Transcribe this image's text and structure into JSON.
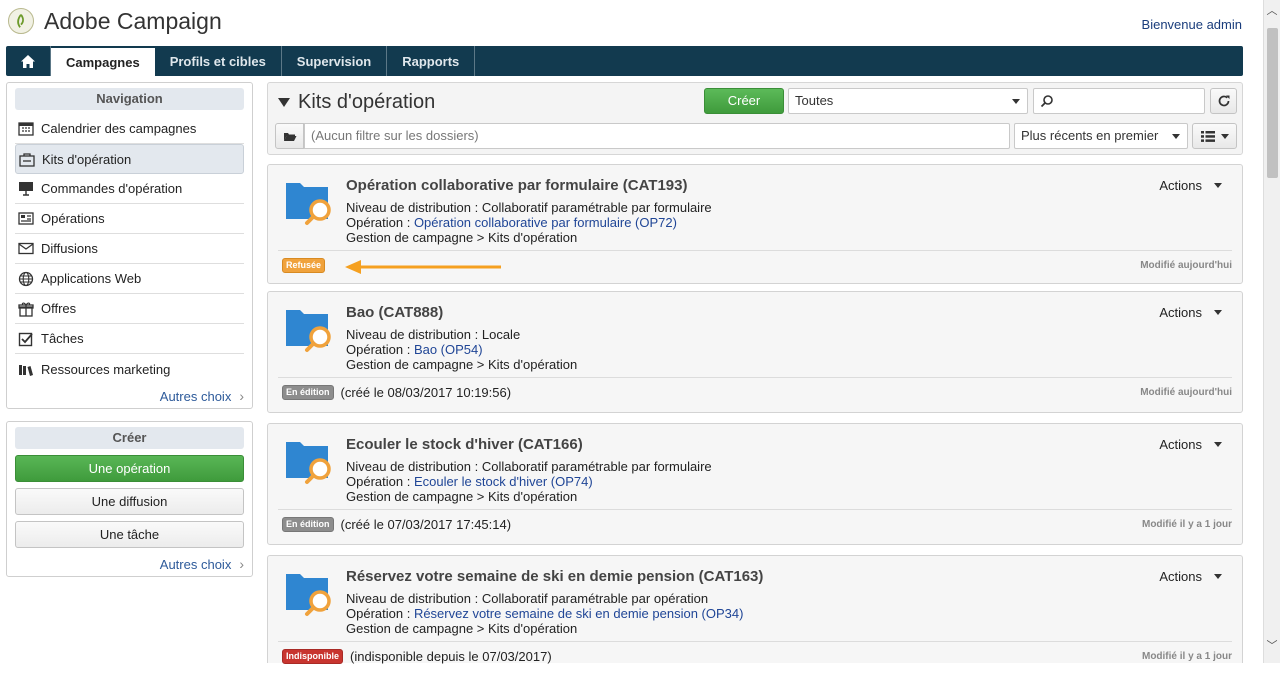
{
  "header": {
    "app_title": "Adobe Campaign",
    "welcome": "Bienvenue admin"
  },
  "topnav": {
    "tabs": [
      {
        "label": "Campagnes",
        "active": true
      },
      {
        "label": "Profils et cibles",
        "active": false
      },
      {
        "label": "Supervision",
        "active": false
      },
      {
        "label": "Rapports",
        "active": false
      }
    ]
  },
  "navigation": {
    "title": "Navigation",
    "items": [
      {
        "label": "Calendrier des campagnes",
        "icon": "calendar-icon"
      },
      {
        "label": "Kits d'opération",
        "icon": "kit-icon",
        "selected": true
      },
      {
        "label": "Commandes d'opération",
        "icon": "presentation-icon"
      },
      {
        "label": "Opérations",
        "icon": "operations-icon"
      },
      {
        "label": "Diffusions",
        "icon": "envelope-icon"
      },
      {
        "label": "Applications Web",
        "icon": "globe-icon"
      },
      {
        "label": "Offres",
        "icon": "gift-icon"
      },
      {
        "label": "Tâches",
        "icon": "checkbox-icon"
      },
      {
        "label": "Ressources marketing",
        "icon": "books-icon"
      }
    ],
    "more": "Autres choix"
  },
  "create_panel": {
    "title": "Créer",
    "buttons": [
      "Une opération",
      "Une diffusion",
      "Une tâche"
    ],
    "more": "Autres choix"
  },
  "main": {
    "title": "Kits d'opération",
    "create_label": "Créer",
    "filter_select": "Toutes",
    "search_placeholder": "",
    "folder_filter": "(Aucun filtre sur les dossiers)",
    "sort_select": "Plus récents en premier"
  },
  "cards": [
    {
      "title": "Opération collaborative par formulaire (CAT193)",
      "distribution_label": "Niveau de distribution : ",
      "distribution": "Collaboratif paramétrable par formulaire",
      "operation_label": "Opération : ",
      "operation": "Opération collaborative par formulaire (OP72)",
      "path": "Gestion de campagne > Kits d'opération",
      "actions": "Actions",
      "status": "Refusée",
      "status_type": "refused",
      "status_note": "",
      "modified": "Modifié aujourd'hui"
    },
    {
      "title": "Bao (CAT888)",
      "distribution_label": "Niveau de distribution : ",
      "distribution": "Locale",
      "operation_label": "Opération : ",
      "operation": "Bao (OP54)",
      "path": "Gestion de campagne > Kits d'opération",
      "actions": "Actions",
      "status": "En édition",
      "status_type": "edit",
      "status_note": "(créé le 08/03/2017 10:19:56)",
      "modified": "Modifié aujourd'hui"
    },
    {
      "title": "Ecouler le stock d'hiver (CAT166)",
      "distribution_label": "Niveau de distribution : ",
      "distribution": "Collaboratif paramétrable par formulaire",
      "operation_label": "Opération : ",
      "operation": "Ecouler le stock d'hiver (OP74)",
      "path": "Gestion de campagne > Kits d'opération",
      "actions": "Actions",
      "status": "En édition",
      "status_type": "edit",
      "status_note": "(créé le 07/03/2017 17:45:14)",
      "modified": "Modifié il y a 1 jour"
    },
    {
      "title": "Réservez votre semaine de ski en demie pension (CAT163)",
      "distribution_label": "Niveau de distribution : ",
      "distribution": "Collaboratif paramétrable par opération",
      "operation_label": "Opération : ",
      "operation": "Réservez votre semaine de ski en demie pension (OP34)",
      "path": "Gestion de campagne > Kits d'opération",
      "actions": "Actions",
      "status": "Indisponible",
      "status_type": "unavail",
      "status_note": "(indisponible depuis le 07/03/2017)",
      "modified": "Modifié il y a 1 jour"
    }
  ],
  "colors": {
    "topnav_bg": "#123a4f",
    "primary_green": "#4caa49",
    "link_blue": "#1f4596",
    "folder_blue": "#2f86d1",
    "search_orange": "#f0a23c"
  }
}
